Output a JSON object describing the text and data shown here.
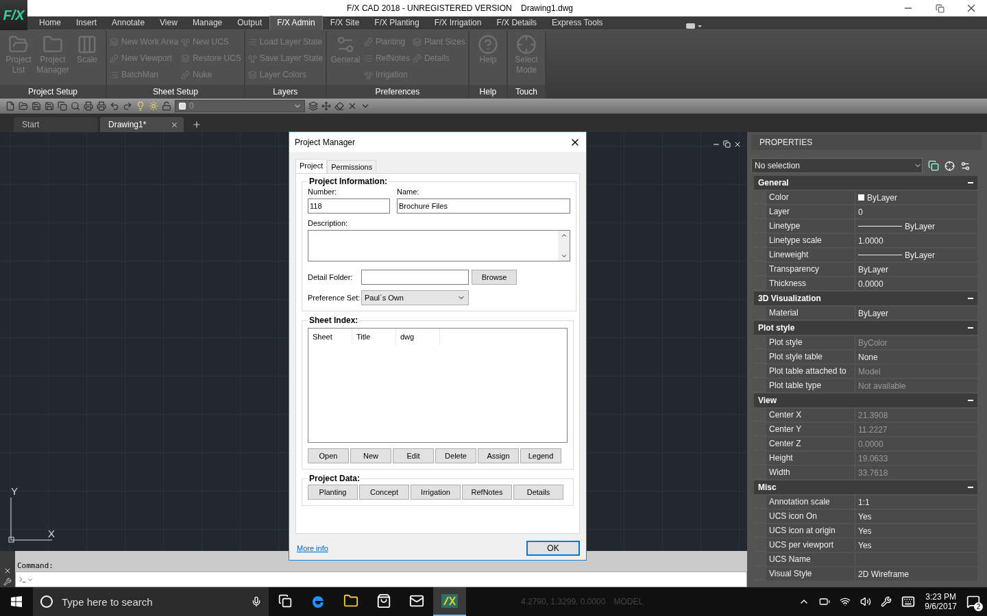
{
  "window": {
    "logo": "F/X",
    "title": "F/X CAD 2018 - UNREGISTERED VERSION    Drawing1.dwg"
  },
  "menu_tabs": [
    {
      "label": "Home",
      "selected": false
    },
    {
      "label": "Insert",
      "selected": false
    },
    {
      "label": "Annotate",
      "selected": false
    },
    {
      "label": "View",
      "selected": false
    },
    {
      "label": "Manage",
      "selected": false
    },
    {
      "label": "Output",
      "selected": false
    },
    {
      "label": "F/X Admin",
      "selected": true
    },
    {
      "label": "F/X Site",
      "selected": false
    },
    {
      "label": "F/X Planting",
      "selected": false
    },
    {
      "label": "F/X Irrigation",
      "selected": false
    },
    {
      "label": "F/X Details",
      "selected": false
    },
    {
      "label": "Express Tools",
      "selected": false
    }
  ],
  "ribbon": [
    {
      "title": "Project Setup",
      "groups": [
        {
          "kind": "large",
          "label": "Project List",
          "disabled": true
        },
        {
          "kind": "large",
          "label": "Project Manager",
          "disabled": true
        },
        {
          "kind": "large",
          "label": "Scale",
          "disabled": true
        }
      ]
    },
    {
      "title": "Sheet Setup",
      "groups": [
        {
          "kind": "column",
          "items": [
            {
              "label": "New Work Area",
              "disabled": true
            },
            {
              "label": "New Viewport",
              "disabled": true
            },
            {
              "label": "BatchMan",
              "disabled": true
            }
          ]
        },
        {
          "kind": "column",
          "items": [
            {
              "label": "New UCS",
              "disabled": true
            },
            {
              "label": "Restore UCS",
              "disabled": true
            },
            {
              "label": "Nuke",
              "disabled": true
            }
          ]
        }
      ]
    },
    {
      "title": "Layers",
      "groups": [
        {
          "kind": "column",
          "items": [
            {
              "label": "Load Layer State",
              "disabled": true
            },
            {
              "label": "Save Layer State",
              "disabled": true
            },
            {
              "label": "Layer Colors",
              "disabled": true
            }
          ]
        }
      ]
    },
    {
      "title": "Preferences",
      "groups": [
        {
          "kind": "large",
          "label": "General",
          "disabled": true
        },
        {
          "kind": "column",
          "items": [
            {
              "label": "Planting",
              "disabled": true
            },
            {
              "label": "RefNotes",
              "disabled": true
            },
            {
              "label": "Irrigation",
              "disabled": true
            }
          ]
        },
        {
          "kind": "column",
          "items": [
            {
              "label": "Plant Sizes",
              "disabled": true
            },
            {
              "label": "Details",
              "disabled": true
            }
          ]
        }
      ]
    },
    {
      "title": "Help",
      "groups": [
        {
          "kind": "large",
          "label": "Help",
          "disabled": true
        }
      ]
    },
    {
      "title": "Touch",
      "groups": [
        {
          "kind": "large",
          "label": "Select Mode",
          "disabled": true
        }
      ]
    }
  ],
  "quick_access": {
    "layer": "0"
  },
  "document_tabs": [
    {
      "label": "Start",
      "selected": false
    },
    {
      "label": "Drawing1*",
      "selected": true
    }
  ],
  "ucs": {
    "x": "X",
    "y": "Y"
  },
  "properties": {
    "title": "PROPERTIES",
    "selection": "No selection",
    "sections": [
      {
        "title": "General",
        "expanded": true,
        "rows": [
          {
            "label": "Color",
            "value": "ByLayer",
            "kind": "swatch",
            "dimmed": false
          },
          {
            "label": "Layer",
            "value": "0",
            "kind": "text",
            "dimmed": false
          },
          {
            "label": "Linetype",
            "value": "ByLayer",
            "kind": "line",
            "dimmed": false
          },
          {
            "label": "Linetype scale",
            "value": "1.0000",
            "kind": "text",
            "dimmed": false
          },
          {
            "label": "Lineweight",
            "value": "ByLayer",
            "kind": "line",
            "dimmed": false
          },
          {
            "label": "Transparency",
            "value": "ByLayer",
            "kind": "text",
            "dimmed": false
          },
          {
            "label": "Thickness",
            "value": "0.0000",
            "kind": "text",
            "dimmed": false
          }
        ]
      },
      {
        "title": "3D Visualization",
        "expanded": true,
        "rows": [
          {
            "label": "Material",
            "value": "ByLayer",
            "kind": "text",
            "dimmed": false
          }
        ]
      },
      {
        "title": "Plot style",
        "expanded": true,
        "rows": [
          {
            "label": "Plot style",
            "value": "ByColor",
            "kind": "text",
            "dimmed": true
          },
          {
            "label": "Plot style table",
            "value": "None",
            "kind": "text",
            "dimmed": false
          },
          {
            "label": "Plot table attached to",
            "value": "Model",
            "kind": "text",
            "dimmed": true
          },
          {
            "label": "Plot table type",
            "value": "Not available",
            "kind": "text",
            "dimmed": true
          }
        ]
      },
      {
        "title": "View",
        "expanded": true,
        "rows": [
          {
            "label": "Center X",
            "value": "21.3908",
            "kind": "text",
            "dimmed": true
          },
          {
            "label": "Center Y",
            "value": "11.2227",
            "kind": "text",
            "dimmed": true
          },
          {
            "label": "Center Z",
            "value": "0.0000",
            "kind": "text",
            "dimmed": true
          },
          {
            "label": "Height",
            "value": "19.0633",
            "kind": "text",
            "dimmed": true
          },
          {
            "label": "Width",
            "value": "33.7618",
            "kind": "text",
            "dimmed": true
          }
        ]
      },
      {
        "title": "Misc",
        "expanded": true,
        "rows": [
          {
            "label": "Annotation scale",
            "value": "1:1",
            "kind": "text",
            "dimmed": false
          },
          {
            "label": "UCS icon On",
            "value": "Yes",
            "kind": "text",
            "dimmed": false
          },
          {
            "label": "UCS icon at origin",
            "value": "Yes",
            "kind": "text",
            "dimmed": false
          },
          {
            "label": "UCS per viewport",
            "value": "Yes",
            "kind": "text",
            "dimmed": false
          },
          {
            "label": "UCS Name",
            "kind": "text",
            "dimmed": false
          },
          {
            "label": "Visual Style",
            "value": "2D Wireframe",
            "kind": "text",
            "dimmed": false
          }
        ]
      }
    ]
  },
  "dialog": {
    "title": "Project Manager",
    "tabs": [
      {
        "label": "Project",
        "selected": true
      },
      {
        "label": "Permissions",
        "selected": false
      }
    ],
    "project_information": {
      "title": "Project Information:",
      "number_label": "Number:",
      "number": "118",
      "name_label": "Name:",
      "name": "Brochure Files",
      "description_label": "Description:",
      "detail_folder_label": "Detail Folder:",
      "browse": "Browse",
      "preference_set_label": "Preference Set:",
      "preference_set": "Paul`s Own"
    },
    "sheet_index": {
      "title": "Sheet Index:",
      "columns": [
        "Sheet",
        "Title",
        "dwg"
      ],
      "buttons": [
        "Open",
        "New",
        "Edit",
        "Delete",
        "Assign",
        "Legend"
      ]
    },
    "project_data": {
      "title": "Project Data:",
      "buttons": [
        "Planting",
        "Concept",
        "Irrigation",
        "RefNotes",
        "Details"
      ]
    },
    "more_info": "More info",
    "ok": "OK"
  },
  "command": {
    "label": "Command:"
  },
  "status_bar": {
    "coordinates": "4.2790, 1.3299, 0.0000",
    "mode": "MODEL"
  },
  "taskbar": {
    "search_placeholder": "Type here to search",
    "apps": [
      {
        "kind": "taskview",
        "selected": false
      },
      {
        "kind": "edge",
        "selected": false
      },
      {
        "kind": "explorer",
        "selected": false
      },
      {
        "kind": "store",
        "selected": false
      },
      {
        "kind": "mail",
        "selected": false
      },
      {
        "kind": "fx",
        "selected": true
      }
    ],
    "time": "3:23 PM",
    "date": "9/6/2017",
    "notifications": "2"
  }
}
